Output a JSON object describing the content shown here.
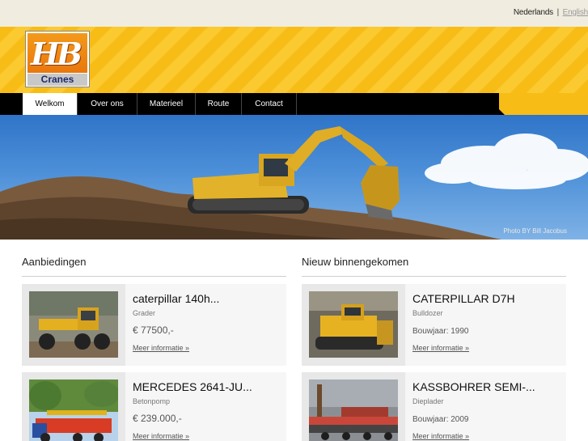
{
  "language": {
    "nl": "Nederlands",
    "separator": "|",
    "en": "English"
  },
  "logo": {
    "letters": "HB",
    "name": "Cranes"
  },
  "nav": [
    "Welkom",
    "Over ons",
    "Materieel",
    "Route",
    "Contact"
  ],
  "hero": {
    "credit": "Photo BY Bill Jacobus"
  },
  "offers": {
    "title": "Aanbiedingen",
    "items": [
      {
        "name": "caterpillar 140h...",
        "category": "Grader",
        "price": "€ 77500,-",
        "more": "Meer informatie »"
      },
      {
        "name": "MERCEDES 2641-JU...",
        "category": "Betonpomp",
        "price": "€ 239.000,-",
        "more": "Meer informatie »"
      }
    ]
  },
  "new_arrivals": {
    "title": "Nieuw binnengekomen",
    "items": [
      {
        "name": "CATERPILLAR D7H",
        "category": "Bulldozer",
        "year": "Bouwjaar: 1990",
        "more": "Meer informatie »"
      },
      {
        "name": "KASSBOHRER SEMI-...",
        "category": "Dieplader",
        "year": "Bouwjaar: 2009",
        "more": "Meer informatie »"
      }
    ]
  },
  "colors": {
    "brand_yellow": "#f7bd16",
    "nav_bg": "#000000",
    "logo_orange": "#e9770d"
  }
}
